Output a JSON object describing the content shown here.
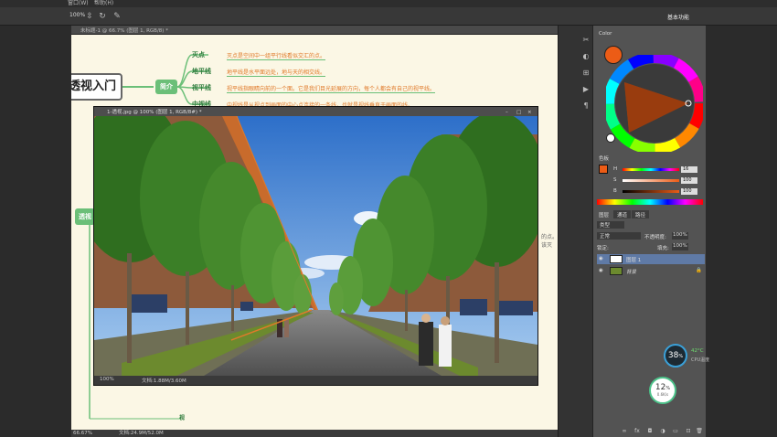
{
  "menu": {
    "window": "窗口(W)",
    "help": "帮助(H)"
  },
  "options": {
    "zoom": "100%",
    "workspace": "基本功能"
  },
  "document": {
    "tab_title": "未标题-1 @ 66.7% (图层 1, RGB/8) *",
    "status_zoom": "66.67%",
    "status_doc": "文档:24.9M/52.0M"
  },
  "mindmap": {
    "root": "透视入门",
    "branch_intro": "简介",
    "branch_persp": "透视",
    "nodes": [
      {
        "label": "灭点",
        "desc": "灭点是空间中一组平行线看似交汇的点。"
      },
      {
        "label": "地平线",
        "desc": "地平线是水平面远处，地与天的相交线。"
      },
      {
        "label": "视平线",
        "desc": "视平线指眼睛向前的一个面。它是我们目光延展的方向，每个人都会有自己的视平线。"
      },
      {
        "label": "中视线",
        "desc": "中视线是从视点到画面的中心点连接的一条线，也就是视线垂直于画面的线。"
      }
    ],
    "extra_text": "的点。该灭",
    "bottom_node": "视"
  },
  "image_window": {
    "title": "1-透视.jpg @ 100% (图层 1, RGB/8#) *",
    "zoom": "100%",
    "doc": "文档:1.88M/3.60M"
  },
  "colors": {
    "tab_color": "Color",
    "tab_swatches": "色板",
    "tab_adjust": "调整",
    "foreground": "#ec5c16",
    "background": "#ffffff",
    "panel_bg": "#535353",
    "accent_green": "#6bbf78",
    "accent_orange": "#e07a2a"
  },
  "color_sliders": {
    "h_label": "H",
    "s_label": "S",
    "b_label": "B",
    "h_value": "16",
    "s_value": "100",
    "b_value": "100",
    "unit": "%"
  },
  "layers": {
    "tab_layers": "图层",
    "tab_channels": "通道",
    "tab_paths": "路径",
    "kind": "类型",
    "blend_mode": "正常",
    "opacity_label": "不透明度:",
    "opacity_value": "100%",
    "lock_label": "锁定:",
    "fill_label": "填充:",
    "fill_value": "100%",
    "items": [
      {
        "name": "图层 1"
      },
      {
        "name": "背景"
      }
    ]
  },
  "system": {
    "cpu_percent": "38",
    "cpu_percent_unit": "%",
    "cpu_temp": "42°C",
    "cpu_label": "CPU温度",
    "net_percent": "12",
    "net_percent_unit": "%",
    "net_speed": "0.6K/s"
  }
}
